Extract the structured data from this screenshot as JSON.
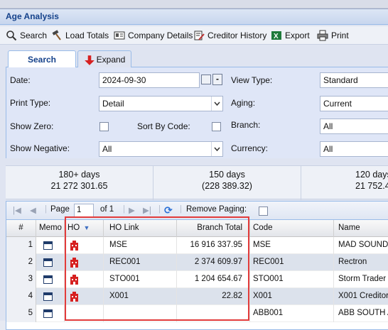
{
  "window": {
    "title": "Age Analysis"
  },
  "toolbar": {
    "search": "Search",
    "load_totals": "Load Totals",
    "company_details": "Company Details",
    "creditor_history": "Creditor History",
    "export": "Export",
    "print": "Print"
  },
  "tabs": {
    "search": "Search",
    "expand": "Expand"
  },
  "form": {
    "date_label": "Date:",
    "date_value": "2024-09-30",
    "view_type_label": "View Type:",
    "view_type_value": "Standard",
    "print_type_label": "Print Type:",
    "print_type_value": "Detail",
    "aging_label": "Aging:",
    "aging_value": "Current",
    "show_zero_label": "Show Zero:",
    "sort_by_code_label": "Sort By Code:",
    "branch_label": "Branch:",
    "branch_value": "All",
    "show_negative_label": "Show Negative:",
    "show_negative_value": "All",
    "currency_label": "Currency:",
    "currency_value": "All"
  },
  "summary": [
    {
      "label": "180+ days",
      "value": "21 272 301.65"
    },
    {
      "label": "150 days",
      "value": "(228 389.32)"
    },
    {
      "label": "120 days",
      "value": "21 752.4"
    }
  ],
  "pager": {
    "page_label": "Page",
    "page_value": "1",
    "of_label": "of 1",
    "remove_paging": "Remove Paging:"
  },
  "columns": {
    "num": "#",
    "memo": "Memo",
    "ho": "HO",
    "ho_link": "HO Link",
    "branch_total": "Branch Total",
    "code": "Code",
    "name": "Name"
  },
  "rows": [
    {
      "n": "1",
      "ho_link": "MSE",
      "branch_total": "16 916 337.95",
      "code": "MSE",
      "name": "MAD SOUND E"
    },
    {
      "n": "2",
      "ho_link": "REC001",
      "branch_total": "2 374 609.97",
      "code": "REC001",
      "name": "Rectron"
    },
    {
      "n": "3",
      "ho_link": "STO001",
      "branch_total": "1 204 654.67",
      "code": "STO001",
      "name": "Storm Trader S"
    },
    {
      "n": "4",
      "ho_link": "X001",
      "branch_total": "22.82",
      "code": "X001",
      "name": "X001 Creditor"
    },
    {
      "n": "5",
      "ho_link": "",
      "branch_total": "",
      "code": "ABB001",
      "name": "ABB SOUTH AF"
    }
  ],
  "colors": {
    "title_text": "#15428b",
    "highlight": "#e23b3b",
    "ho_icon": "#d62020"
  }
}
